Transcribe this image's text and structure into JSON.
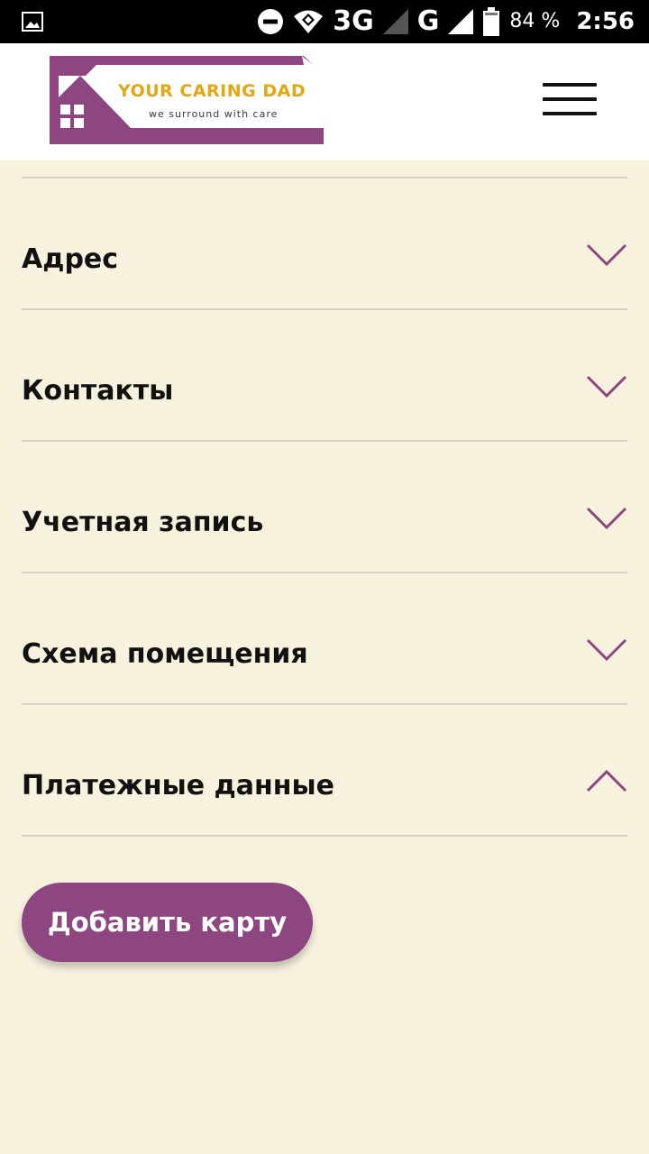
{
  "status_bar": {
    "network_1": "3G",
    "network_2": "G",
    "battery": "84 %",
    "time": "2:56",
    "icons": [
      "image-notification-icon",
      "do-not-disturb-icon",
      "wifi-icon",
      "signal-icon",
      "battery-icon"
    ]
  },
  "header": {
    "logo": {
      "title": "YOUR CARING DAD",
      "tagline": "we surround with care"
    },
    "menu_icon": "hamburger-menu-icon"
  },
  "accordion": {
    "items": [
      {
        "label": "Адрес",
        "state": "collapsed"
      },
      {
        "label": "Контакты",
        "state": "collapsed"
      },
      {
        "label": "Учетная запись",
        "state": "collapsed"
      },
      {
        "label": "Схема помещения",
        "state": "collapsed"
      },
      {
        "label": "Платежные данные",
        "state": "expanded"
      }
    ]
  },
  "payment": {
    "add_card_label": "Добавить карту"
  },
  "colors": {
    "background": "#f7f2de",
    "brand_purple": "#8d467f",
    "brand_gold": "#e4a712",
    "divider": "#d7d3c3"
  }
}
